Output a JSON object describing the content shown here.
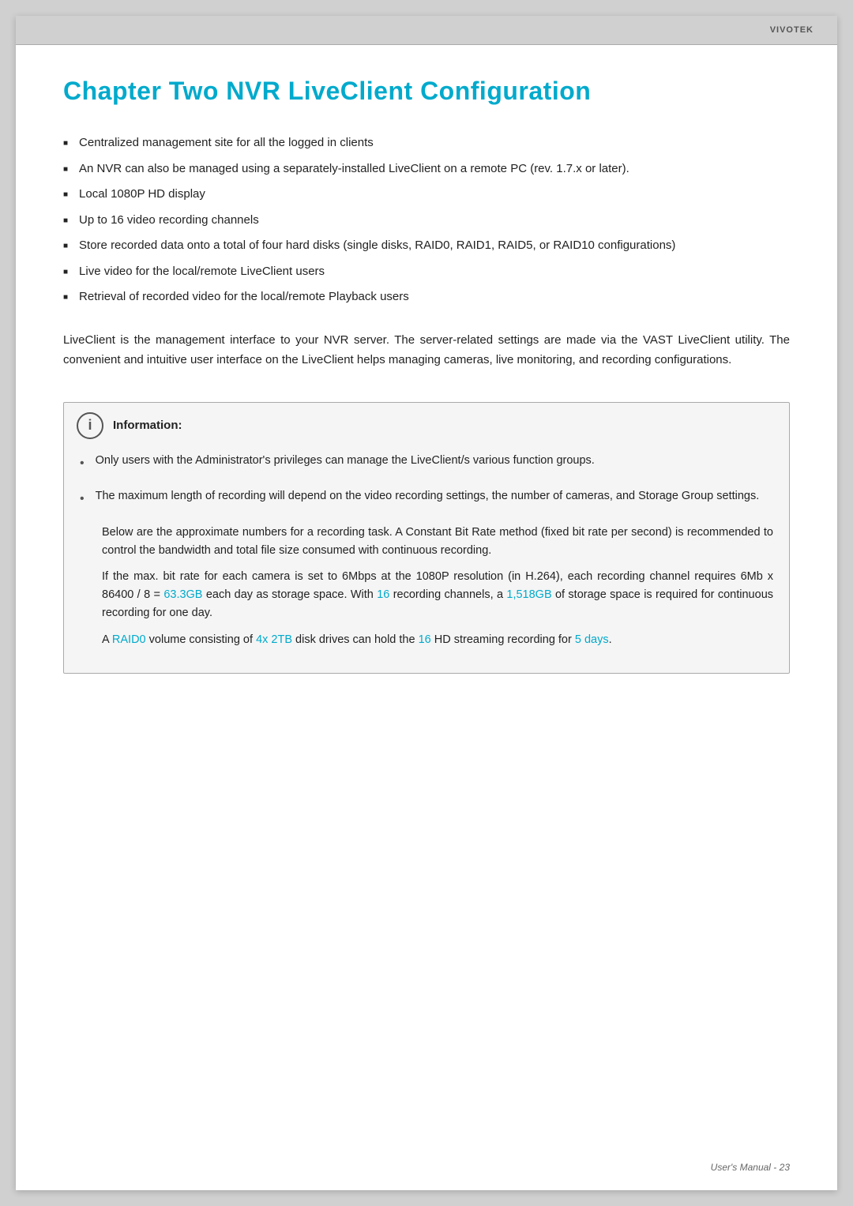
{
  "header": {
    "brand": "VIVOTEK"
  },
  "chapter": {
    "title": "Chapter Two  NVR LiveClient Configuration"
  },
  "bullets": [
    "Centralized management site for all the logged in clients",
    "An NVR can also be managed using a separately-installed LiveClient on a remote PC (rev. 1.7.x or later).",
    "Local 1080P HD display",
    "Up to 16 video recording channels",
    "Store recorded data onto a total of four hard disks (single disks, RAID0, RAID1, RAID5, or RAID10 configurations)",
    "Live video for the local/remote LiveClient users",
    "Retrieval of recorded video for the local/remote Playback users"
  ],
  "intro": "LiveClient is the management interface to your NVR server. The server-related settings are made via the VAST LiveClient utility. The convenient and intuitive user interface on the LiveClient helps managing cameras, live monitoring, and recording configurations.",
  "info_box": {
    "header": "Information:",
    "icon_letter": "i",
    "bullet1_text": "Only users with the Administrator's privileges can manage the LiveClient/s various function groups.",
    "bullet2_text": "The maximum length of recording will depend on the video recording settings, the number of cameras, and Storage Group settings.",
    "sub1": "Below are the approximate numbers for a recording task. A Constant Bit Rate method (fixed bit rate per second) is recommended to control the bandwidth and total file size consumed with continuous recording.",
    "sub2_part1": "If the max. bit rate for each camera is set to 6Mbps at the 1080P resolution (in H.264), each recording channel requires 6Mb x 86400 / 8 = ",
    "sub2_highlight1": "63.3GB",
    "sub2_part2": " each day as storage space. With ",
    "sub2_highlight2": "16",
    "sub2_part3": " recording channels, a ",
    "sub2_highlight3": "1,518GB",
    "sub2_part4": " of storage space is required for continuous recording for one day.",
    "sub3_part1": "A ",
    "sub3_highlight1": "RAID0",
    "sub3_part2": " volume consisting of ",
    "sub3_highlight2": "4x 2TB",
    "sub3_part3": " disk drives can hold the ",
    "sub3_highlight3": "16",
    "sub3_part4": " HD streaming recording for ",
    "sub3_highlight4": "5 days",
    "sub3_part5": "."
  },
  "footer": {
    "text": "User's Manual - 23"
  }
}
